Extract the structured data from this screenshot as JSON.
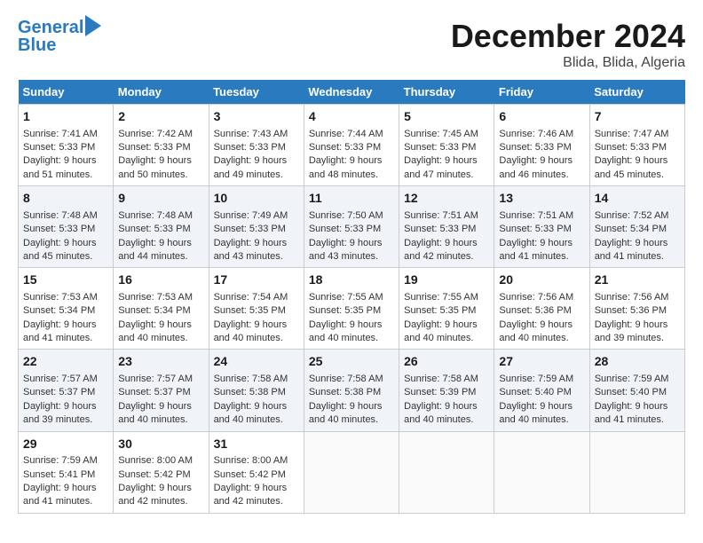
{
  "header": {
    "logo_line1": "General",
    "logo_line2": "Blue",
    "month_title": "December 2024",
    "location": "Blida, Blida, Algeria"
  },
  "days_of_week": [
    "Sunday",
    "Monday",
    "Tuesday",
    "Wednesday",
    "Thursday",
    "Friday",
    "Saturday"
  ],
  "weeks": [
    [
      {
        "day": "1",
        "sunrise": "7:41 AM",
        "sunset": "5:33 PM",
        "daylight": "9 hours and 51 minutes."
      },
      {
        "day": "2",
        "sunrise": "7:42 AM",
        "sunset": "5:33 PM",
        "daylight": "9 hours and 50 minutes."
      },
      {
        "day": "3",
        "sunrise": "7:43 AM",
        "sunset": "5:33 PM",
        "daylight": "9 hours and 49 minutes."
      },
      {
        "day": "4",
        "sunrise": "7:44 AM",
        "sunset": "5:33 PM",
        "daylight": "9 hours and 48 minutes."
      },
      {
        "day": "5",
        "sunrise": "7:45 AM",
        "sunset": "5:33 PM",
        "daylight": "9 hours and 47 minutes."
      },
      {
        "day": "6",
        "sunrise": "7:46 AM",
        "sunset": "5:33 PM",
        "daylight": "9 hours and 46 minutes."
      },
      {
        "day": "7",
        "sunrise": "7:47 AM",
        "sunset": "5:33 PM",
        "daylight": "9 hours and 45 minutes."
      }
    ],
    [
      {
        "day": "8",
        "sunrise": "7:48 AM",
        "sunset": "5:33 PM",
        "daylight": "9 hours and 45 minutes."
      },
      {
        "day": "9",
        "sunrise": "7:48 AM",
        "sunset": "5:33 PM",
        "daylight": "9 hours and 44 minutes."
      },
      {
        "day": "10",
        "sunrise": "7:49 AM",
        "sunset": "5:33 PM",
        "daylight": "9 hours and 43 minutes."
      },
      {
        "day": "11",
        "sunrise": "7:50 AM",
        "sunset": "5:33 PM",
        "daylight": "9 hours and 43 minutes."
      },
      {
        "day": "12",
        "sunrise": "7:51 AM",
        "sunset": "5:33 PM",
        "daylight": "9 hours and 42 minutes."
      },
      {
        "day": "13",
        "sunrise": "7:51 AM",
        "sunset": "5:33 PM",
        "daylight": "9 hours and 41 minutes."
      },
      {
        "day": "14",
        "sunrise": "7:52 AM",
        "sunset": "5:34 PM",
        "daylight": "9 hours and 41 minutes."
      }
    ],
    [
      {
        "day": "15",
        "sunrise": "7:53 AM",
        "sunset": "5:34 PM",
        "daylight": "9 hours and 41 minutes."
      },
      {
        "day": "16",
        "sunrise": "7:53 AM",
        "sunset": "5:34 PM",
        "daylight": "9 hours and 40 minutes."
      },
      {
        "day": "17",
        "sunrise": "7:54 AM",
        "sunset": "5:35 PM",
        "daylight": "9 hours and 40 minutes."
      },
      {
        "day": "18",
        "sunrise": "7:55 AM",
        "sunset": "5:35 PM",
        "daylight": "9 hours and 40 minutes."
      },
      {
        "day": "19",
        "sunrise": "7:55 AM",
        "sunset": "5:35 PM",
        "daylight": "9 hours and 40 minutes."
      },
      {
        "day": "20",
        "sunrise": "7:56 AM",
        "sunset": "5:36 PM",
        "daylight": "9 hours and 40 minutes."
      },
      {
        "day": "21",
        "sunrise": "7:56 AM",
        "sunset": "5:36 PM",
        "daylight": "9 hours and 39 minutes."
      }
    ],
    [
      {
        "day": "22",
        "sunrise": "7:57 AM",
        "sunset": "5:37 PM",
        "daylight": "9 hours and 39 minutes."
      },
      {
        "day": "23",
        "sunrise": "7:57 AM",
        "sunset": "5:37 PM",
        "daylight": "9 hours and 40 minutes."
      },
      {
        "day": "24",
        "sunrise": "7:58 AM",
        "sunset": "5:38 PM",
        "daylight": "9 hours and 40 minutes."
      },
      {
        "day": "25",
        "sunrise": "7:58 AM",
        "sunset": "5:38 PM",
        "daylight": "9 hours and 40 minutes."
      },
      {
        "day": "26",
        "sunrise": "7:58 AM",
        "sunset": "5:39 PM",
        "daylight": "9 hours and 40 minutes."
      },
      {
        "day": "27",
        "sunrise": "7:59 AM",
        "sunset": "5:40 PM",
        "daylight": "9 hours and 40 minutes."
      },
      {
        "day": "28",
        "sunrise": "7:59 AM",
        "sunset": "5:40 PM",
        "daylight": "9 hours and 41 minutes."
      }
    ],
    [
      {
        "day": "29",
        "sunrise": "7:59 AM",
        "sunset": "5:41 PM",
        "daylight": "9 hours and 41 minutes."
      },
      {
        "day": "30",
        "sunrise": "8:00 AM",
        "sunset": "5:42 PM",
        "daylight": "9 hours and 42 minutes."
      },
      {
        "day": "31",
        "sunrise": "8:00 AM",
        "sunset": "5:42 PM",
        "daylight": "9 hours and 42 minutes."
      },
      null,
      null,
      null,
      null
    ]
  ]
}
